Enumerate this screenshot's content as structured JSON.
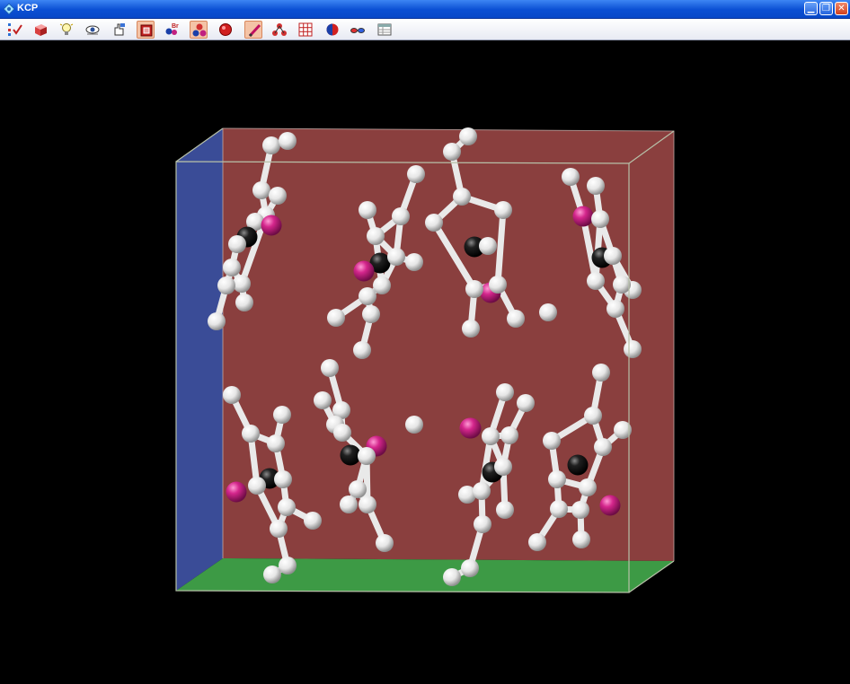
{
  "window": {
    "title": "KCP",
    "app_icon": "molecule-app-icon",
    "controls": [
      {
        "name": "minimize-button",
        "icon": "minimize-icon",
        "glyph": "▁"
      },
      {
        "name": "maximize-button",
        "icon": "restore-icon",
        "glyph": "❐"
      },
      {
        "name": "close-button",
        "icon": "close-icon",
        "glyph": "✕"
      }
    ]
  },
  "toolbar": {
    "buttons": [
      {
        "name": "select-check-button",
        "icon": "checklist-icon",
        "pressed": false
      },
      {
        "name": "crystal-cell-button",
        "icon": "box-icon",
        "pressed": false
      },
      {
        "name": "lighting-button",
        "icon": "lightbulb-icon",
        "pressed": false
      },
      {
        "name": "view-button",
        "icon": "eye-icon",
        "pressed": false
      },
      {
        "name": "measure-button",
        "icon": "hand-pointer-icon",
        "pressed": false
      },
      {
        "name": "unit-cell-button",
        "icon": "unit-cell-icon",
        "pressed": true
      },
      {
        "name": "bromine-atoms-button",
        "icon": "atoms-br-icon",
        "pressed": false
      },
      {
        "name": "atoms-button",
        "icon": "atoms-icon",
        "pressed": true
      },
      {
        "name": "polyhedra-button",
        "icon": "polyhedron-icon",
        "pressed": false
      },
      {
        "name": "bonds-button",
        "icon": "bond-pencil-icon",
        "pressed": true
      },
      {
        "name": "molecule-button",
        "icon": "molecule-icon",
        "pressed": false
      },
      {
        "name": "lattice-grid-button",
        "icon": "lattice-icon",
        "pressed": false
      },
      {
        "name": "sphere-button",
        "icon": "sphere-icon",
        "pressed": false
      },
      {
        "name": "stereo-glasses-button",
        "icon": "glasses-icon",
        "pressed": false
      },
      {
        "name": "table-button",
        "icon": "table-icon",
        "pressed": false
      }
    ]
  },
  "scene": {
    "background": "#000000",
    "colors": {
      "back_face": "#8a3f3e",
      "left_face": "#3a4c97",
      "bottom_face": "#3d9a45",
      "cell_edge": "#b7c0a8",
      "carbon_atom": "#f2f2f2",
      "metal_atom": "#141414",
      "halide_atom": "#d4268c"
    }
  }
}
